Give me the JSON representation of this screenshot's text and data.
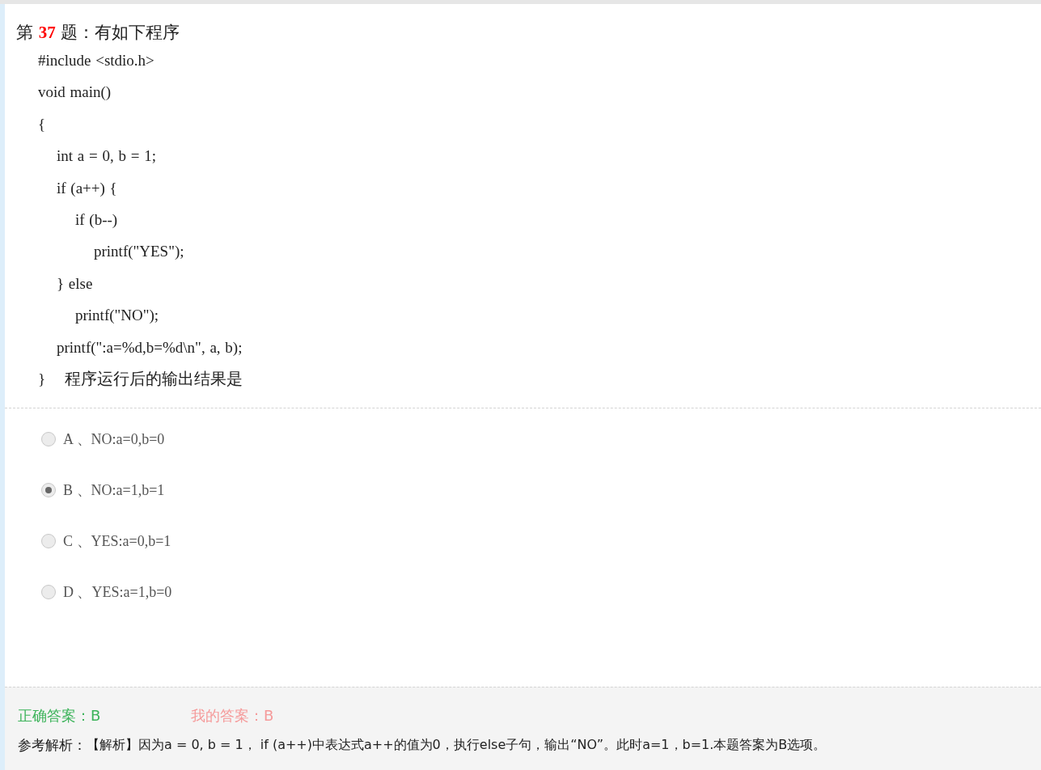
{
  "question": {
    "prefix": "第",
    "number": "37",
    "suffix": "题：有如下程序",
    "code": [
      "#include <stdio.h>",
      "void main()",
      "{",
      "    int a = 0, b = 1;",
      "    if (a++) {",
      "        if (b--)",
      "            printf(\"YES\");",
      "    } else",
      "        printf(\"NO\");",
      "    printf(\":a=%d,b=%d\\n\", a, b);",
      "}"
    ],
    "tail": "程序运行后的输出结果是"
  },
  "options": [
    {
      "letter": "A 、",
      "text": "NO:a=0,b=0",
      "selected": false
    },
    {
      "letter": "B 、",
      "text": "NO:a=1,b=1",
      "selected": true
    },
    {
      "letter": "C 、",
      "text": "YES:a=0,b=1",
      "selected": false
    },
    {
      "letter": "D 、",
      "text": "YES:a=1,b=0",
      "selected": false
    }
  ],
  "answers": {
    "correct": "正确答案：B",
    "mine": "我的答案：B"
  },
  "explanation": {
    "label": "参考解析：",
    "text": "【解析】因为a = 0, b = 1， if (a++)中表达式a++的值为0，执行else子句，输出“NO”。此时a=1，b=1.本题答案为B选项。"
  }
}
